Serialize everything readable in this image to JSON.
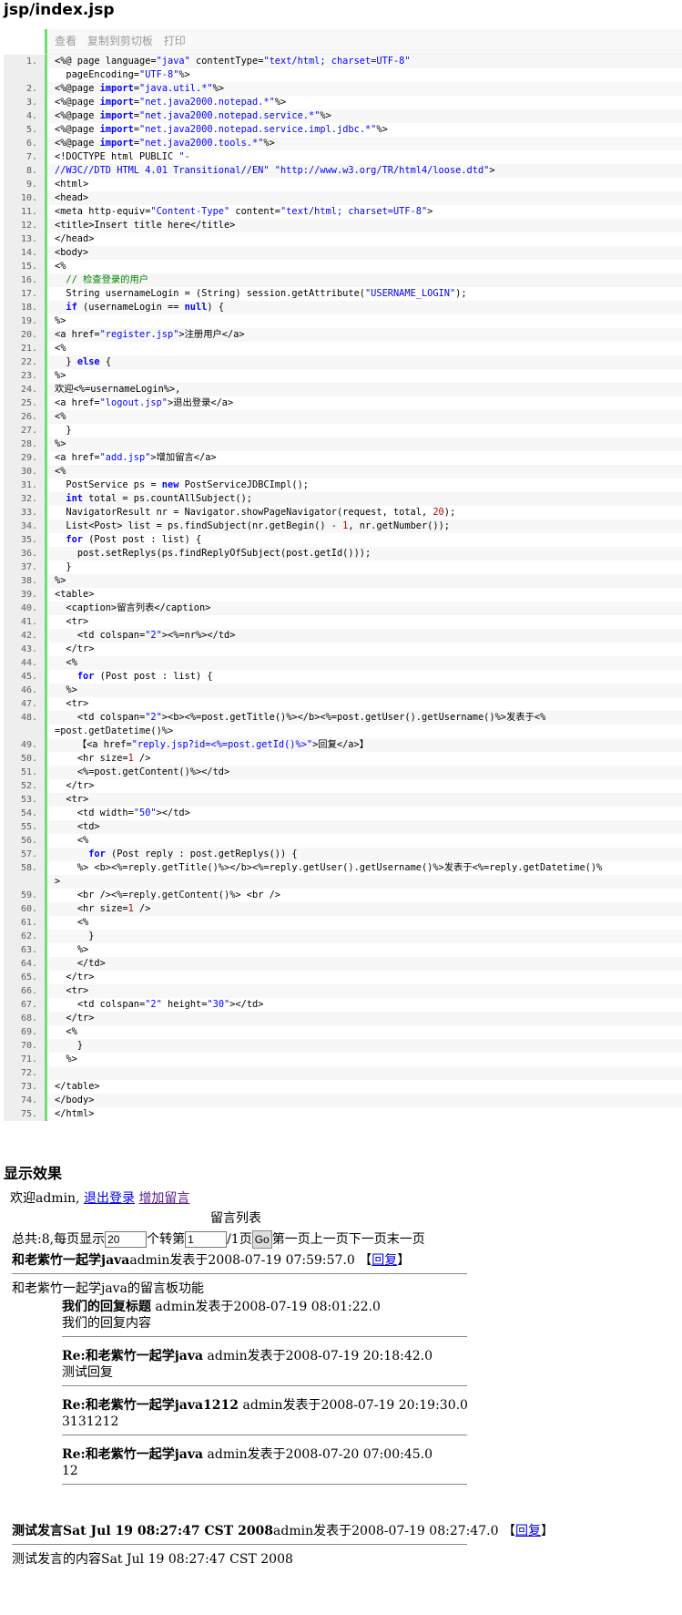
{
  "page_title": "jsp/index.jsp",
  "toolbar": {
    "view": "查看",
    "copy": "复制到剪切板",
    "print": "打印"
  },
  "code_lines": [
    {
      "n": "1.",
      "h": "&lt;%@ page language=<s>\"java\"</s> contentType=<s>\"text/html; charset=UTF-8\"</s>"
    },
    {
      "n": "",
      "h": "  pageEncoding=<s>\"UTF-8\"</s>%&gt;"
    },
    {
      "n": "2.",
      "h": "&lt;%@page <k>import</k>=<s>\"java.util.*\"</s>%&gt;"
    },
    {
      "n": "3.",
      "h": "&lt;%@page <k>import</k>=<s>\"net.java2000.notepad.*\"</s>%&gt;"
    },
    {
      "n": "4.",
      "h": "&lt;%@page <k>import</k>=<s>\"net.java2000.notepad.service.*\"</s>%&gt;"
    },
    {
      "n": "5.",
      "h": "&lt;%@page <k>import</k>=<s>\"net.java2000.notepad.service.impl.jdbc.*\"</s>%&gt;"
    },
    {
      "n": "6.",
      "h": "&lt;%@page <k>import</k>=<s>\"net.java2000.tools.*\"</s>%&gt;"
    },
    {
      "n": "7.",
      "h": "&lt;!DOCTYPE html PUBLIC <s>\"-</s>"
    },
    {
      "n": "8.",
      "h": "<s>//W3C//DTD HTML 4.01 Transitional//EN\"</s> <s>\"http://www.w3.org/TR/html4/loose.dtd\"</s>&gt;"
    },
    {
      "n": "9.",
      "h": "&lt;html&gt;"
    },
    {
      "n": "10.",
      "h": "&lt;head&gt;"
    },
    {
      "n": "11.",
      "h": "&lt;meta http-equiv=<s>\"Content-Type\"</s> content=<s>\"text/html; charset=UTF-8\"</s>&gt;"
    },
    {
      "n": "12.",
      "h": "&lt;title&gt;Insert title here&lt;/title&gt;"
    },
    {
      "n": "13.",
      "h": "&lt;/head&gt;"
    },
    {
      "n": "14.",
      "h": "&lt;body&gt;"
    },
    {
      "n": "15.",
      "h": "&lt;%"
    },
    {
      "n": "16.",
      "h": "  <c>// 检查登录的用户</c>"
    },
    {
      "n": "17.",
      "h": "  String usernameLogin = (String) session.getAttribute(<s>\"USERNAME_LOGIN\"</s>);"
    },
    {
      "n": "18.",
      "h": "  <k>if</k> (usernameLogin == <k>null</k>) {"
    },
    {
      "n": "19.",
      "h": "%&gt;"
    },
    {
      "n": "20.",
      "h": "&lt;a href=<s>\"register.jsp\"</s>&gt;注册用户&lt;/a&gt;"
    },
    {
      "n": "21.",
      "h": "&lt;%"
    },
    {
      "n": "22.",
      "h": "  } <k>else</k> {"
    },
    {
      "n": "23.",
      "h": "%&gt;"
    },
    {
      "n": "24.",
      "h": "欢迎&lt;%=usernameLogin%&gt;,"
    },
    {
      "n": "25.",
      "h": "&lt;a href=<s>\"logout.jsp\"</s>&gt;退出登录&lt;/a&gt;"
    },
    {
      "n": "26.",
      "h": "&lt;%"
    },
    {
      "n": "27.",
      "h": "  }"
    },
    {
      "n": "28.",
      "h": "%&gt;"
    },
    {
      "n": "29.",
      "h": "&lt;a href=<s>\"add.jsp\"</s>&gt;增加留言&lt;/a&gt;"
    },
    {
      "n": "30.",
      "h": "&lt;%"
    },
    {
      "n": "31.",
      "h": "  PostService ps = <k>new</k> PostServiceJDBCImpl();"
    },
    {
      "n": "32.",
      "h": "  <k>int</k> total = ps.countAllSubject();"
    },
    {
      "n": "33.",
      "h": "  NavigatorResult nr = Navigator.showPageNavigator(request, total, <n>20</n>);"
    },
    {
      "n": "34.",
      "h": "  List&lt;Post&gt; list = ps.findSubject(nr.getBegin() - <n>1</n>, nr.getNumber());"
    },
    {
      "n": "35.",
      "h": "  <k>for</k> (Post post : list) {"
    },
    {
      "n": "36.",
      "h": "    post.setReplys(ps.findReplyOfSubject(post.getId()));"
    },
    {
      "n": "37.",
      "h": "  }"
    },
    {
      "n": "38.",
      "h": "%&gt;"
    },
    {
      "n": "39.",
      "h": "&lt;table&gt;"
    },
    {
      "n": "40.",
      "h": "  &lt;caption&gt;留言列表&lt;/caption&gt;"
    },
    {
      "n": "41.",
      "h": "  &lt;tr&gt;"
    },
    {
      "n": "42.",
      "h": "    &lt;td colspan=<s>\"2\"</s>&gt;&lt;%=nr%&gt;&lt;/td&gt;"
    },
    {
      "n": "43.",
      "h": "  &lt;/tr&gt;"
    },
    {
      "n": "44.",
      "h": "  &lt;%"
    },
    {
      "n": "45.",
      "h": "    <k>for</k> (Post post : list) {"
    },
    {
      "n": "46.",
      "h": "  %&gt;"
    },
    {
      "n": "47.",
      "h": "  &lt;tr&gt;"
    },
    {
      "n": "48.",
      "h": "    &lt;td colspan=<s>\"2\"</s>&gt;&lt;b&gt;&lt;%=post.getTitle()%&gt;&lt;/b&gt;&lt;%=post.getUser().getUsername()%&gt;发表于&lt;%"
    },
    {
      "n": "",
      "h": "=post.getDatetime()%&gt;"
    },
    {
      "n": "49.",
      "h": "    【&lt;a href=<s>\"reply.jsp?id=&lt;%=post.getId()%&gt;\"</s>&gt;回复&lt;/a&gt;】"
    },
    {
      "n": "50.",
      "h": "    &lt;hr size=<n>1</n> /&gt;"
    },
    {
      "n": "51.",
      "h": "    &lt;%=post.getContent()%&gt;&lt;/td&gt;"
    },
    {
      "n": "52.",
      "h": "  &lt;/tr&gt;"
    },
    {
      "n": "53.",
      "h": "  &lt;tr&gt;"
    },
    {
      "n": "54.",
      "h": "    &lt;td width=<s>\"50\"</s>&gt;&lt;/td&gt;"
    },
    {
      "n": "55.",
      "h": "    &lt;td&gt;"
    },
    {
      "n": "56.",
      "h": "    &lt;%"
    },
    {
      "n": "57.",
      "h": "      <k>for</k> (Post reply : post.getReplys()) {"
    },
    {
      "n": "58.",
      "h": "    %&gt; &lt;b&gt;&lt;%=reply.getTitle()%&gt;&lt;/b&gt;&lt;%=reply.getUser().getUsername()%&gt;发表于&lt;%=reply.getDatetime()%"
    },
    {
      "n": "",
      "h": "&gt;"
    },
    {
      "n": "59.",
      "h": "    &lt;br /&gt;&lt;%=reply.getContent()%&gt; &lt;br /&gt;"
    },
    {
      "n": "60.",
      "h": "    &lt;hr size=<n>1</n> /&gt;"
    },
    {
      "n": "61.",
      "h": "    &lt;%"
    },
    {
      "n": "62.",
      "h": "      }"
    },
    {
      "n": "63.",
      "h": "    %&gt;"
    },
    {
      "n": "64.",
      "h": "    &lt;/td&gt;"
    },
    {
      "n": "65.",
      "h": "  &lt;/tr&gt;"
    },
    {
      "n": "66.",
      "h": "  &lt;tr&gt;"
    },
    {
      "n": "67.",
      "h": "    &lt;td colspan=<s>\"2\"</s> height=<s>\"30\"</s>&gt;&lt;/td&gt;"
    },
    {
      "n": "68.",
      "h": "  &lt;/tr&gt;"
    },
    {
      "n": "69.",
      "h": "  &lt;%"
    },
    {
      "n": "70.",
      "h": "    }"
    },
    {
      "n": "71.",
      "h": "  %&gt;"
    },
    {
      "n": "72.",
      "h": ""
    },
    {
      "n": "73.",
      "h": "&lt;/table&gt;"
    },
    {
      "n": "74.",
      "h": "&lt;/body&gt;"
    },
    {
      "n": "75.",
      "h": "&lt;/html&gt;"
    }
  ],
  "result": {
    "heading": "显示效果",
    "welcome_prefix": "欢迎admin,",
    "logout_link": "退出登录",
    "add_link": "增加留言",
    "caption": "留言列表",
    "pager": {
      "text1": "总共:8,每页显示",
      "per_page": "20",
      "text2": "个转第",
      "page": "1",
      "text3": "/1页",
      "go": "Go",
      "text4": "第一页上一页下一页末一页"
    },
    "posts": [
      {
        "title": "和老紫竹一起学java",
        "meta": "admin发表于2008-07-19 07:59:57.0",
        "bracket_open": "【",
        "reply_link": "回复",
        "bracket_close": "】",
        "content": "和老紫竹一起学java的留言板功能",
        "replies": [
          {
            "title": "我们的回复标题",
            "meta": "admin发表于2008-07-19 08:01:22.0",
            "content": "我们的回复内容"
          },
          {
            "title": "Re:和老紫竹一起学java",
            "meta": "admin发表于2008-07-19 20:18:42.0",
            "content": "测试回复"
          },
          {
            "title": "Re:和老紫竹一起学java1212",
            "meta": "admin发表于2008-07-19 20:19:30.0",
            "content": "3131212"
          },
          {
            "title": "Re:和老紫竹一起学java",
            "meta": "admin发表于2008-07-20 07:00:45.0",
            "content": "12"
          }
        ]
      },
      {
        "title": "测试发言Sat Jul 19 08:27:47 CST 2008",
        "meta": "admin发表于2008-07-19 08:27:47.0",
        "bracket_open": "【",
        "reply_link": "回复",
        "bracket_close": "】",
        "content": "测试发言的内容Sat Jul 19 08:27:47 CST 2008",
        "replies": []
      }
    ]
  }
}
